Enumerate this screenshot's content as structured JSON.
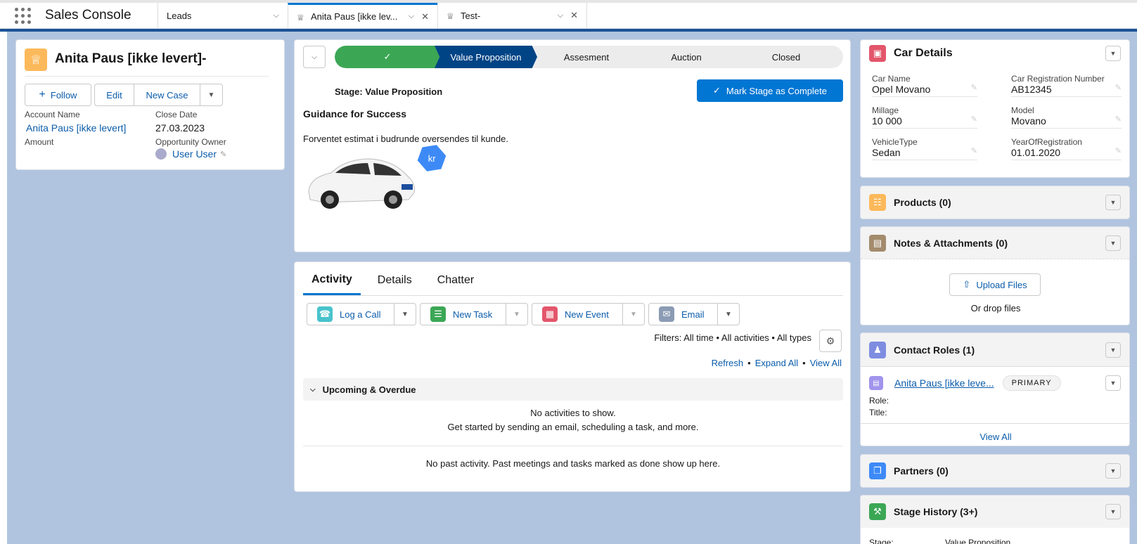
{
  "nav": {
    "app_name": "Sales Console",
    "tabs": [
      {
        "label": "Leads"
      },
      {
        "label": "Anita Paus [ikke lev..."
      },
      {
        "label": "Test-"
      }
    ]
  },
  "record": {
    "title": "Anita Paus [ikke levert]-",
    "follow_label": "Follow",
    "edit_label": "Edit",
    "new_case_label": "New Case",
    "account_name_label": "Account Name",
    "account_name": "Anita Paus [ikke levert]",
    "close_date_label": "Close Date",
    "close_date": "27.03.2023",
    "amount_label": "Amount",
    "owner_label": "Opportunity Owner",
    "owner": "User User"
  },
  "path": {
    "stages": [
      "Value Proposition",
      "Assesment",
      "Auction",
      "Closed"
    ],
    "current_stage_text": "Stage: Value Proposition",
    "mark_complete_label": "Mark Stage as Complete",
    "guidance_title": "Guidance for Success",
    "guidance_text": "Forventet estimat i budrunde oversendes til kunde.",
    "badge": "kr"
  },
  "activity": {
    "tabs": [
      "Activity",
      "Details",
      "Chatter"
    ],
    "log_call": "Log a Call",
    "new_task": "New Task",
    "new_event": "New Event",
    "email": "Email",
    "filters": "Filters: All time • All activities • All types",
    "refresh": "Refresh",
    "expand_all": "Expand All",
    "view_all": "View All",
    "sep": "•",
    "upcoming": "Upcoming & Overdue",
    "no_activities": "No activities to show.",
    "get_started": "Get started by sending an email, scheduling a task, and more.",
    "no_past": "No past activity. Past meetings and tasks marked as done show up here."
  },
  "car": {
    "title": "Car Details",
    "fields": [
      {
        "label": "Car Name",
        "value": "Opel Movano"
      },
      {
        "label": "Car Registration Number",
        "value": "AB12345"
      },
      {
        "label": "Millage",
        "value": "10 000"
      },
      {
        "label": "Model",
        "value": "Movano"
      },
      {
        "label": "VehicleType",
        "value": "Sedan"
      },
      {
        "label": "YearOfRegistration",
        "value": "01.01.2020"
      }
    ]
  },
  "products": {
    "title": "Products (0)"
  },
  "notes": {
    "title": "Notes & Attachments (0)",
    "upload": "Upload Files",
    "drop": "Or drop files"
  },
  "contacts": {
    "title": "Contact Roles (1)",
    "name": "Anita Paus [ikke leve...",
    "badge": "PRIMARY",
    "role": "Role:",
    "title_lbl": "Title:",
    "view_all": "View All"
  },
  "partners": {
    "title": "Partners (0)"
  },
  "stage_history": {
    "title": "Stage History (3+)",
    "stage_lbl": "Stage:",
    "stage_val": "Value Proposition"
  },
  "colors": {
    "brand": "#0176d3",
    "path_done": "#3ba755",
    "path_current": "#014486"
  }
}
